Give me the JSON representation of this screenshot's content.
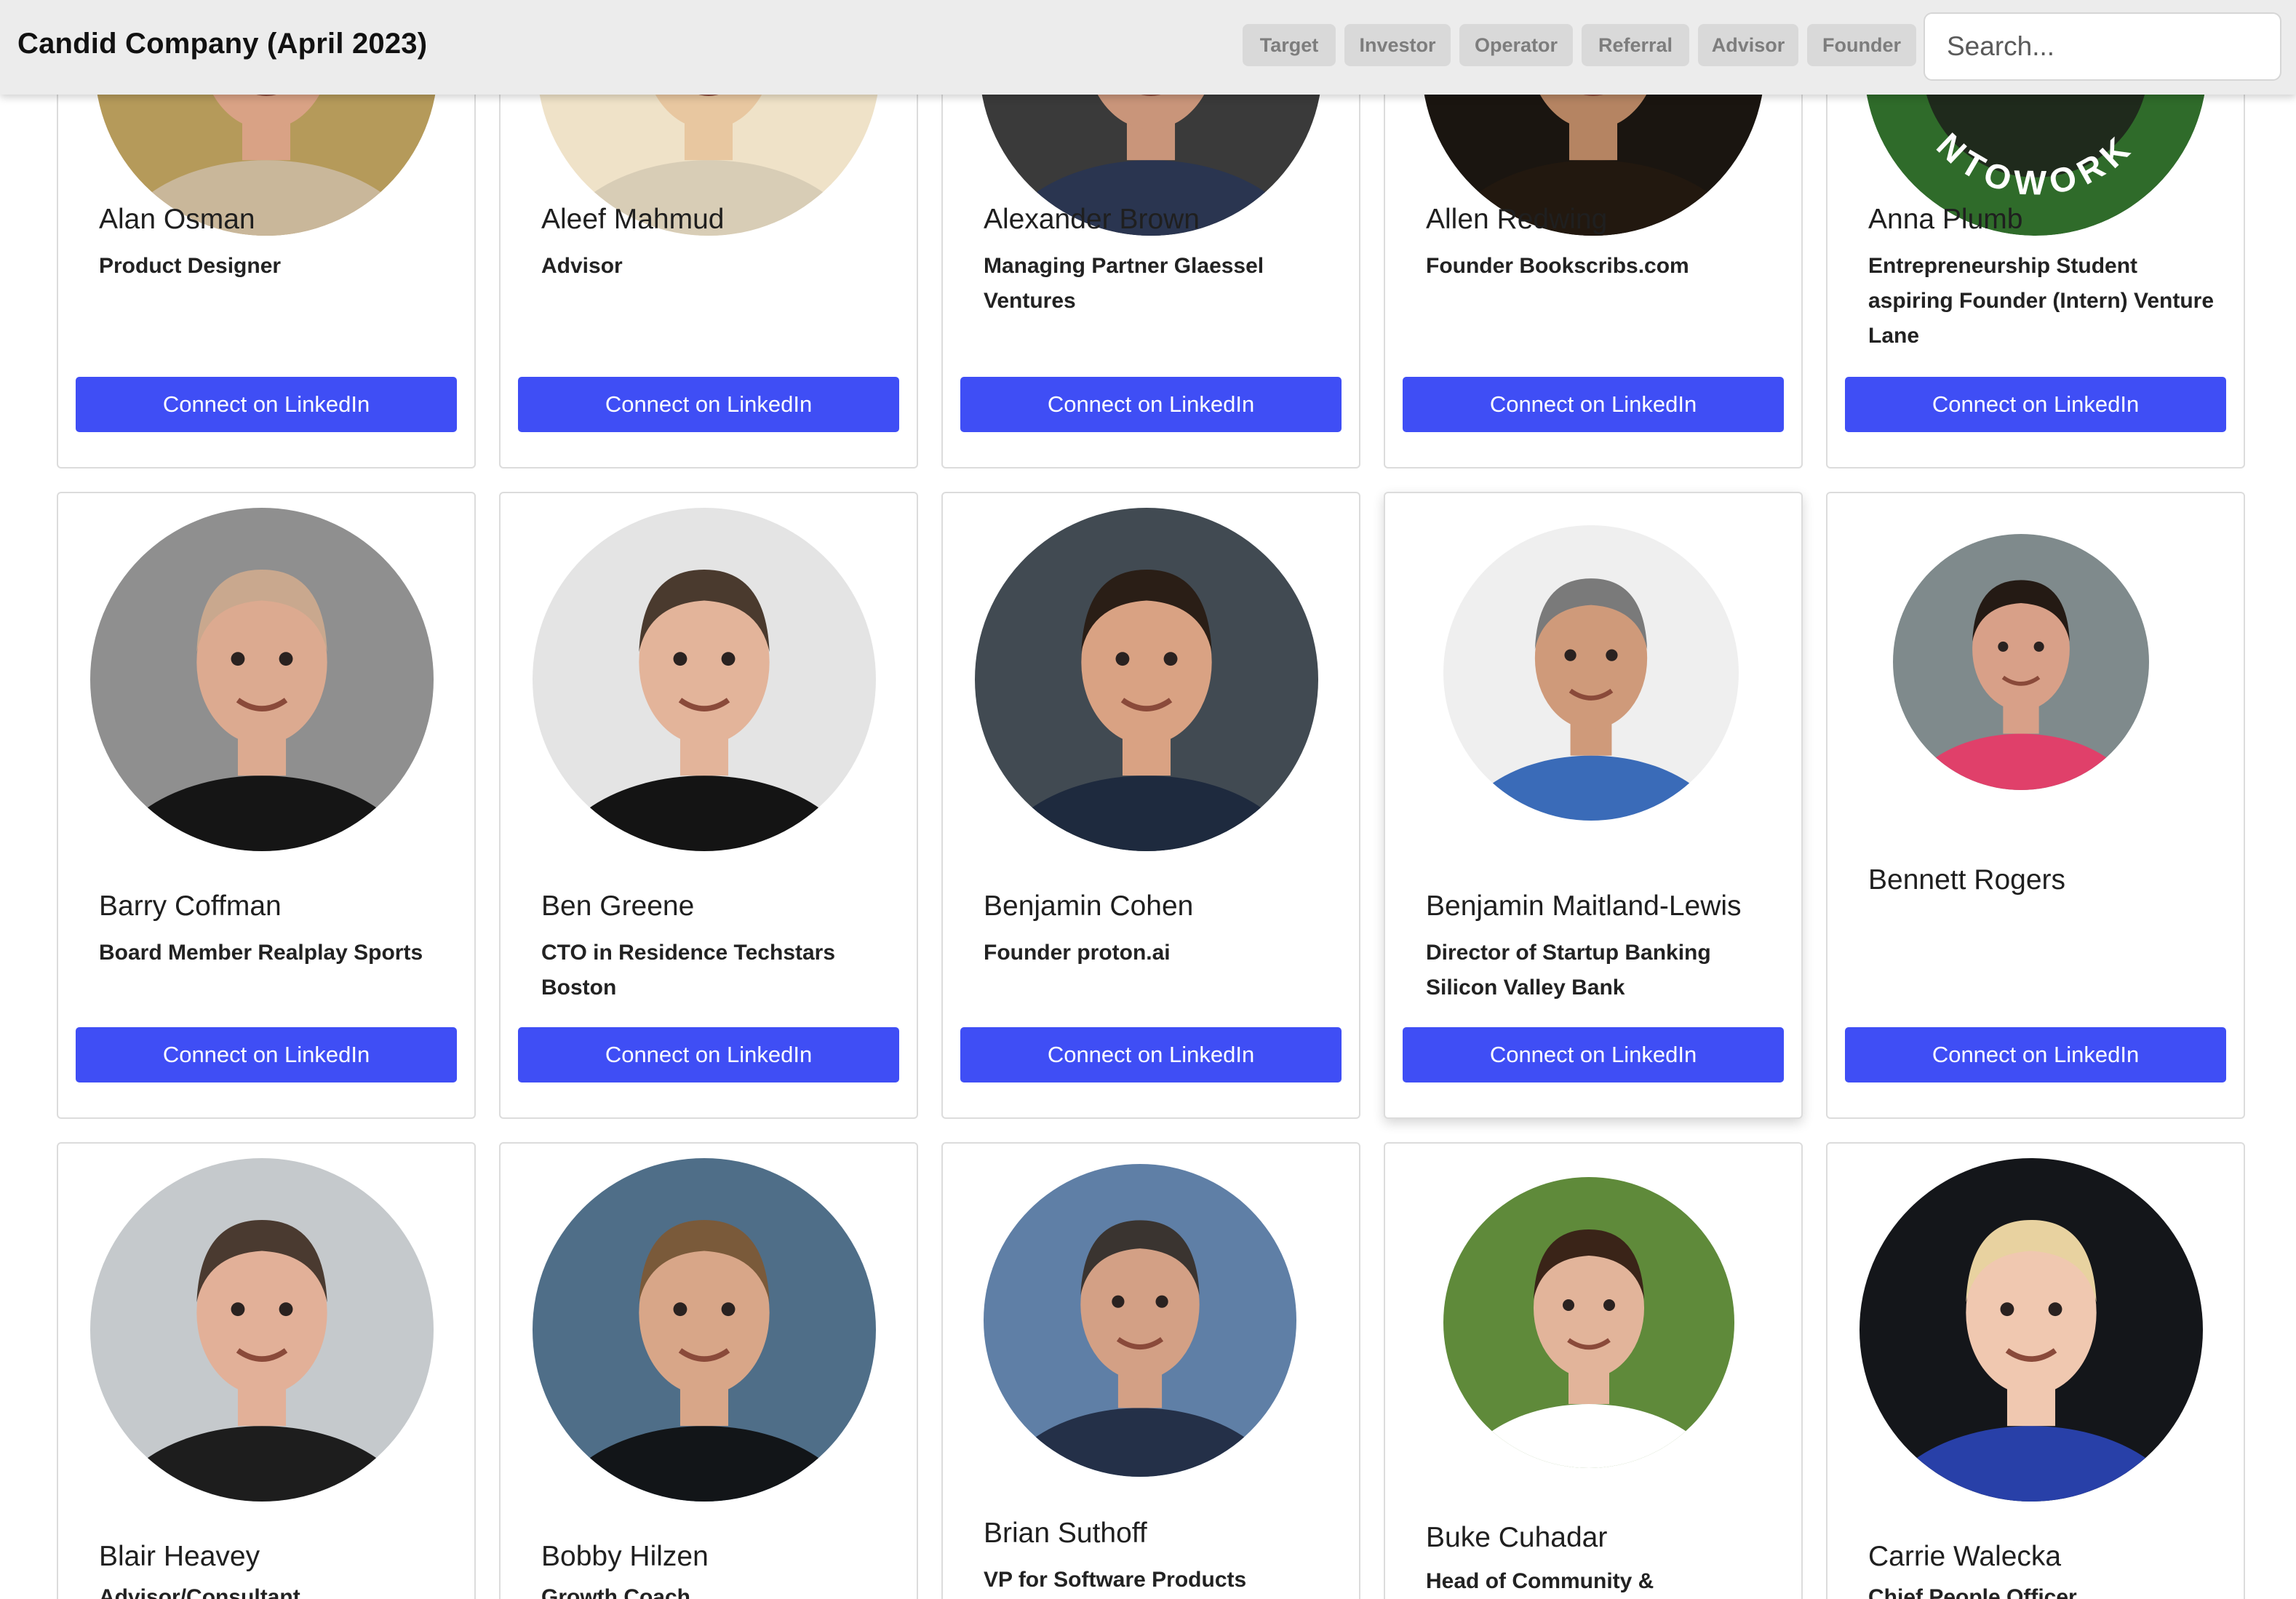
{
  "header": {
    "title": "Candid Company (April 2023)",
    "filters": [
      "Target",
      "Investor",
      "Operator",
      "Referral",
      "Advisor",
      "Founder"
    ],
    "search_placeholder": "Search..."
  },
  "connect_label": "Connect on LinkedIn",
  "rows": [
    [
      {
        "name": "Alan Osman",
        "title": "Product Designer"
      },
      {
        "name": "Aleef Mahmud",
        "title": "Advisor"
      },
      {
        "name": "Alexander Brown",
        "title": "Managing Partner Glaessel Ventures"
      },
      {
        "name": "Allen Redwing",
        "title": "Founder Bookscribs.com"
      },
      {
        "name": "Anna Plumb",
        "title": "Entrepreneurship Student aspiring Founder (Intern) Venture Lane",
        "logo_text": "NTOWORK"
      }
    ],
    [
      {
        "name": "Barry Coffman",
        "title": "Board Member Realplay Sports"
      },
      {
        "name": "Ben Greene",
        "title": "CTO in Residence Techstars Boston"
      },
      {
        "name": "Benjamin Cohen",
        "title": "Founder proton.ai"
      },
      {
        "name": "Benjamin Maitland-Lewis",
        "title": "Director of Startup Banking Silicon Valley Bank"
      },
      {
        "name": "Bennett Rogers",
        "title": ""
      }
    ],
    [
      {
        "name": "Blair Heavey",
        "title": "Advisor/Consultant"
      },
      {
        "name": "Bobby Hilzen",
        "title": "Growth Coach"
      },
      {
        "name": "Brian Suthoff",
        "title": "VP for Software Products"
      },
      {
        "name": "Buke Cuhadar",
        "title": "Head of Community &"
      },
      {
        "name": "Carrie Walecka",
        "title": "Chief People Officer"
      }
    ]
  ],
  "avatar_palettes": [
    [
      {
        "bg": "#b59a5a",
        "skin": "#d9a285",
        "hair": "#6b5a40",
        "shirt": "#c9b79a"
      },
      {
        "bg": "#efe2c8",
        "skin": "#e8c7a0",
        "hair": "#3a2a1e",
        "shirt": "#d8cdb6"
      },
      {
        "bg": "#3a3a3a",
        "skin": "#c9957a",
        "hair": "#2b2018",
        "shirt": "#2a3550"
      },
      {
        "bg": "#1a1510",
        "skin": "#b58462",
        "hair": "#0e0a08",
        "shirt": "#22180f"
      },
      {
        "bg": "#2f6b2a",
        "skin": "#2f6b2a",
        "hair": "#2f6b2a",
        "shirt": "#2f6b2a"
      }
    ],
    [
      {
        "bg": "#8f8f8f",
        "skin": "#dcaa90",
        "hair": "#c9a88e",
        "shirt": "#151515"
      },
      {
        "bg": "#e4e4e4",
        "skin": "#e3b49a",
        "hair": "#4a3a2e",
        "shirt": "#141414"
      },
      {
        "bg": "#414a52",
        "skin": "#d9a283",
        "hair": "#2a1e16",
        "shirt": "#1e2a3e"
      },
      {
        "bg": "#efefef",
        "skin": "#cf9a7a",
        "hair": "#7a7a7a",
        "shirt": "#3a6bb8"
      },
      {
        "bg": "#7f8a8c",
        "skin": "#d8a088",
        "hair": "#241a14",
        "shirt": "#e0406a"
      }
    ],
    [
      {
        "bg": "#c5c9cc",
        "skin": "#e2b098",
        "hair": "#4a3a30",
        "shirt": "#1d1d1d"
      },
      {
        "bg": "#4f6e88",
        "skin": "#d8a688",
        "hair": "#7a5a3a",
        "shirt": "#121518"
      },
      {
        "bg": "#5f7fa6",
        "skin": "#d3a085",
        "hair": "#3a3430",
        "shirt": "#243048"
      },
      {
        "bg": "#5f8a3a",
        "skin": "#e2b49a",
        "hair": "#3a2418",
        "shirt": "#ffffff"
      },
      {
        "bg": "#14161a",
        "skin": "#f0c8b0",
        "hair": "#e8d2a0",
        "shirt": "#2840a8"
      }
    ]
  ]
}
